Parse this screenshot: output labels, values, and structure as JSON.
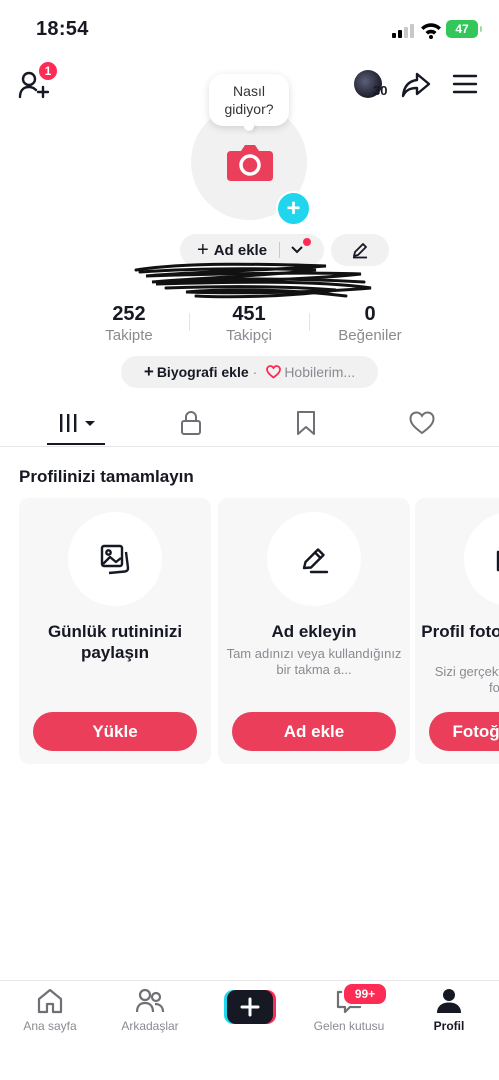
{
  "status_bar": {
    "time": "18:54",
    "battery": "47"
  },
  "top_bar": {
    "friend_requests_badge": "1",
    "story_count": "30"
  },
  "profile": {
    "prompt_bubble": "Nasıl gidiyor?",
    "add_name_label": "Ad ekle",
    "stats": [
      {
        "value": "252",
        "label": "Takipte"
      },
      {
        "value": "451",
        "label": "Takipçi"
      },
      {
        "value": "0",
        "label": "Beğeniler"
      }
    ],
    "bio_add_label": "Biyografi ekle",
    "bio_separator": "·",
    "hobbies_label": "Hobilerim..."
  },
  "section": {
    "title": "Profilinizi tamamlayın"
  },
  "cards": [
    {
      "title": "Günlük rutininizi paylaşın",
      "subtitle": "",
      "button": "Yükle",
      "icon": "photos-icon"
    },
    {
      "title": "Ad ekleyin",
      "subtitle": "Tam adınızı veya kullandığınız bir takma a...",
      "button": "Ad ekle",
      "icon": "pencil-icon"
    },
    {
      "title": "Profil fotoğrafı ekleyin",
      "subtitle": "Sizi gerçekten yansıtan bir fotoğraf",
      "button": "Fotoğraf yükle",
      "icon": "camera-icon"
    }
  ],
  "bottom_nav": [
    {
      "label": "Ana sayfa",
      "icon": "home-icon"
    },
    {
      "label": "Arkadaşlar",
      "icon": "friends-icon"
    },
    {
      "label": "",
      "icon": "create-icon"
    },
    {
      "label": "Gelen kutusu",
      "icon": "inbox-icon"
    },
    {
      "label": "Profil",
      "icon": "profile-icon"
    }
  ],
  "inbox_badge": "99+",
  "colors": {
    "accent": "#fe2c55",
    "button": "#ea3e5a",
    "cyan": "#20d5ec"
  }
}
